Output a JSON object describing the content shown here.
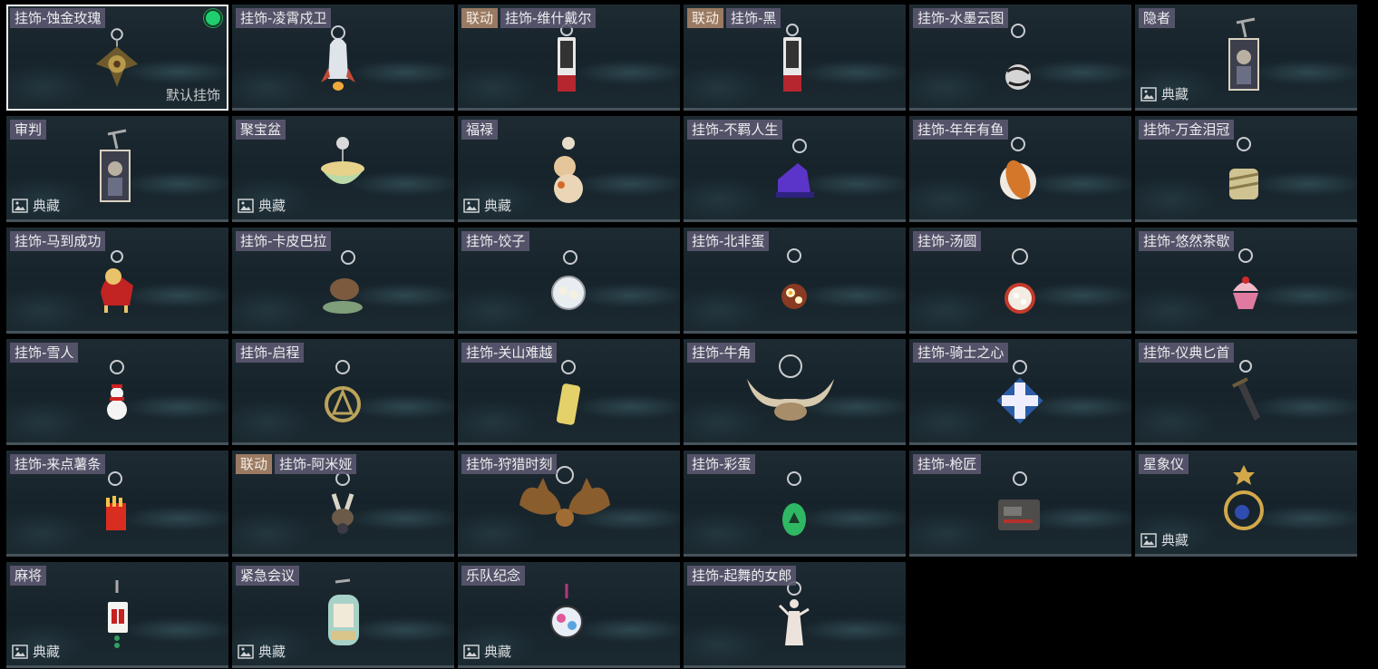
{
  "default_label": "默认挂饰",
  "badge_text": "典藏",
  "collab_tag": "联动",
  "accent_colors": {
    "selected_border": "#f2f2f2",
    "status_active": "#1fcf6f",
    "collab_tag_bg": "#9a7a62",
    "name_tag_bg": "#5c5870"
  },
  "charms": [
    {
      "name": "挂饰-蚀金玫瑰",
      "icon": "rose-charm",
      "selected": true,
      "default": true
    },
    {
      "name": "挂饰-凌霄戍卫",
      "icon": "rocket-charm"
    },
    {
      "name": "挂饰-维什戴尔",
      "icon": "card-charm",
      "collab": true
    },
    {
      "name": "挂饰-黑",
      "icon": "card-charm",
      "collab": true
    },
    {
      "name": "挂饰-水墨云图",
      "icon": "ball-charm"
    },
    {
      "name": "隐者",
      "icon": "tarot-charm",
      "badge": true
    },
    {
      "name": "审判",
      "icon": "tarot-charm",
      "badge": true
    },
    {
      "name": "聚宝盆",
      "icon": "bowl-charm",
      "badge": true
    },
    {
      "name": "福禄",
      "icon": "gourd-charm",
      "badge": true
    },
    {
      "name": "挂饰-不羁人生",
      "icon": "sneaker-charm"
    },
    {
      "name": "挂饰-年年有鱼",
      "icon": "fish-charm"
    },
    {
      "name": "挂饰-万金泪冠",
      "icon": "crown-charm"
    },
    {
      "name": "挂饰-马到成功",
      "icon": "horse-charm"
    },
    {
      "name": "挂饰-卡皮巴拉",
      "icon": "capybara-charm"
    },
    {
      "name": "挂饰-饺子",
      "icon": "plate-charm"
    },
    {
      "name": "挂饰-北非蛋",
      "icon": "pan-charm"
    },
    {
      "name": "挂饰-汤圆",
      "icon": "soup-bowl-charm"
    },
    {
      "name": "挂饰-悠然茶歇",
      "icon": "cupcake-charm"
    },
    {
      "name": "挂饰-雪人",
      "icon": "snowman-charm"
    },
    {
      "name": "挂饰-启程",
      "icon": "medal-charm"
    },
    {
      "name": "挂饰-关山难越",
      "icon": "scroll-charm"
    },
    {
      "name": "挂饰-牛角",
      "icon": "horns-charm"
    },
    {
      "name": "挂饰-骑士之心",
      "icon": "cross-emblem-charm"
    },
    {
      "name": "挂饰-仪典匕首",
      "icon": "dagger-charm"
    },
    {
      "name": "挂饰-来点薯条",
      "icon": "fries-charm"
    },
    {
      "name": "挂饰-阿米娅",
      "icon": "bunny-charm",
      "collab": true
    },
    {
      "name": "挂饰-狩猎时刻",
      "icon": "antlers-charm"
    },
    {
      "name": "挂饰-彩蛋",
      "icon": "egg-charm"
    },
    {
      "name": "挂饰-枪匠",
      "icon": "toolbox-charm"
    },
    {
      "name": "星象仪",
      "icon": "astrolabe-charm",
      "badge": true
    },
    {
      "name": "麻将",
      "icon": "mahjong-charm",
      "badge": true
    },
    {
      "name": "紧急会议",
      "icon": "crew-charm",
      "badge": true
    },
    {
      "name": "乐队纪念",
      "icon": "badge-disc-charm",
      "badge": true
    },
    {
      "name": "挂饰-起舞的女郎",
      "icon": "dancer-charm"
    }
  ]
}
